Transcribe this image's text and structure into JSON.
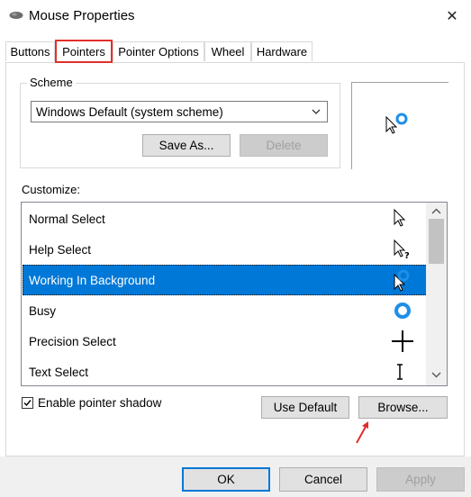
{
  "window": {
    "title": "Mouse Properties",
    "close_glyph": "✕"
  },
  "tabs": [
    {
      "label": "Buttons",
      "active": false
    },
    {
      "label": "Pointers",
      "active": true
    },
    {
      "label": "Pointer Options",
      "active": false
    },
    {
      "label": "Wheel",
      "active": false
    },
    {
      "label": "Hardware",
      "active": false
    }
  ],
  "scheme": {
    "legend": "Scheme",
    "selected": "Windows Default (system scheme)",
    "save_as_label": "Save As...",
    "delete_label": "Delete"
  },
  "customize": {
    "label": "Customize:",
    "items": [
      {
        "label": "Normal Select",
        "icon": "arrow-cursor-icon"
      },
      {
        "label": "Help Select",
        "icon": "help-cursor-icon"
      },
      {
        "label": "Working In Background",
        "icon": "working-cursor-icon",
        "selected": true
      },
      {
        "label": "Busy",
        "icon": "busy-cursor-icon"
      },
      {
        "label": "Precision Select",
        "icon": "crosshair-cursor-icon"
      },
      {
        "label": "Text Select",
        "icon": "ibeam-cursor-icon"
      }
    ]
  },
  "shadow": {
    "label": "Enable pointer shadow",
    "checked": true
  },
  "actions": {
    "use_default_label": "Use Default",
    "browse_label": "Browse..."
  },
  "footer": {
    "ok_label": "OK",
    "cancel_label": "Cancel",
    "apply_label": "Apply"
  },
  "colors": {
    "accent": "#0078d7",
    "highlight_border": "#e0302c",
    "annotation_arrow": "#e0302c"
  }
}
